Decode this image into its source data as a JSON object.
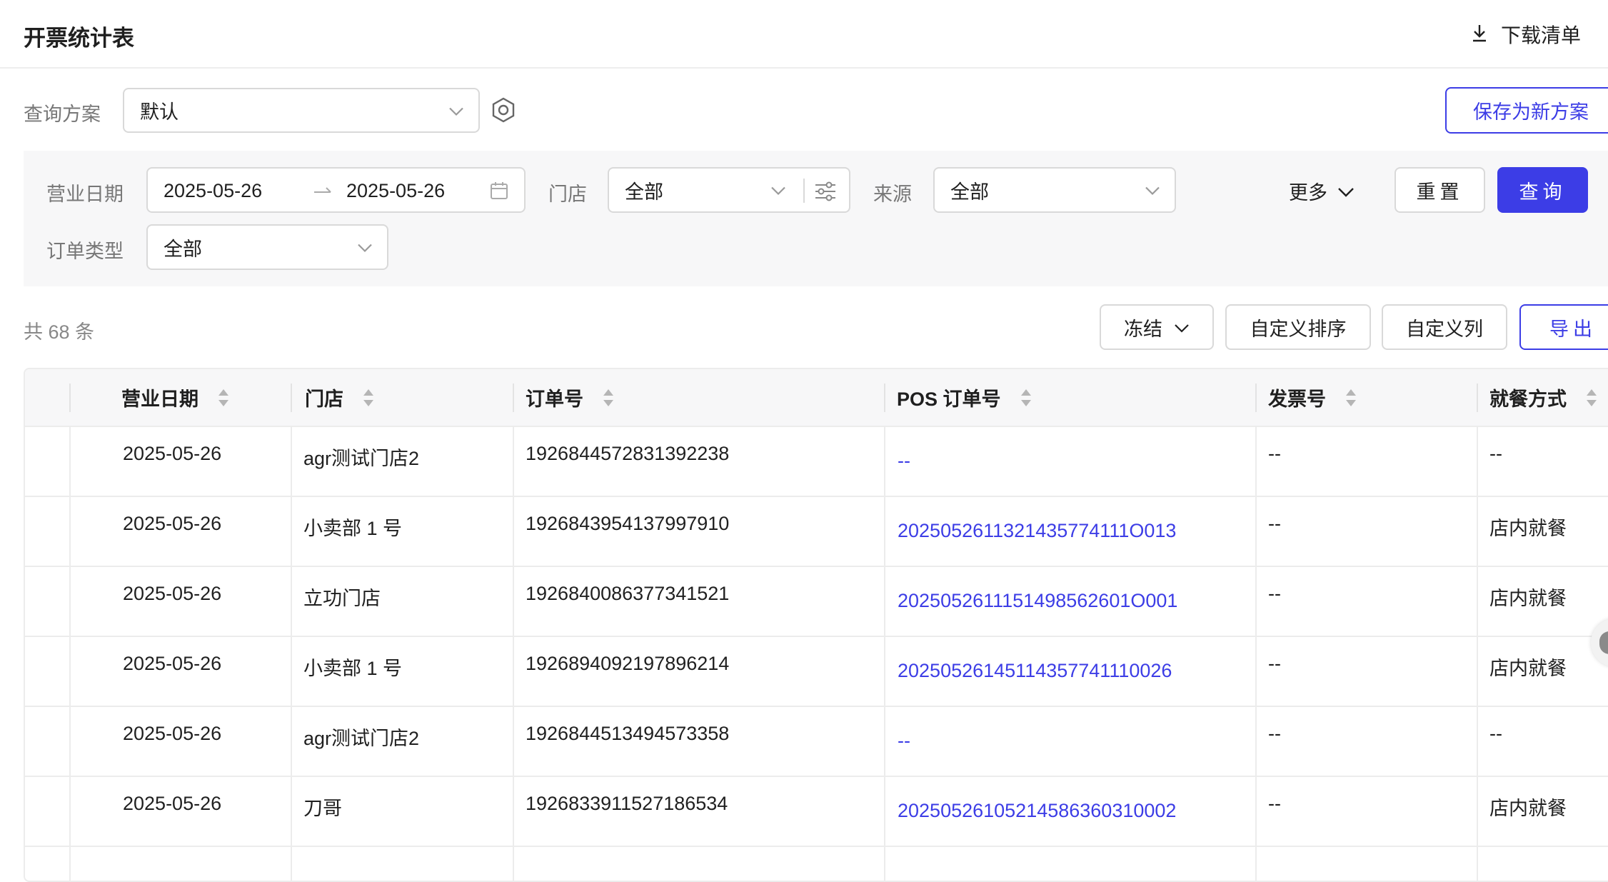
{
  "header": {
    "title": "开票统计表",
    "download_label": "下载清单"
  },
  "plan": {
    "label": "查询方案",
    "value": "默认",
    "save_label": "保存为新方案"
  },
  "filters": {
    "date_label": "营业日期",
    "date_start": "2025-05-26",
    "date_end": "2025-05-26",
    "store_label": "门店",
    "store_value": "全部",
    "source_label": "来源",
    "source_value": "全部",
    "more_label": "更多",
    "reset_label": "重置",
    "query_label": "查询",
    "order_type_label": "订单类型",
    "order_type_value": "全部"
  },
  "toolbar": {
    "total_text": "共 68 条",
    "freeze_label": "冻结",
    "custom_sort_label": "自定义排序",
    "custom_columns_label": "自定义列",
    "export_label": "导出"
  },
  "table": {
    "columns": [
      "营业日期",
      "门店",
      "订单号",
      "POS 订单号",
      "发票号",
      "就餐方式"
    ],
    "rows": [
      {
        "date": "2025-05-26",
        "store": "agr测试门店2",
        "order_no": "1926844572831392238",
        "pos_no": "--",
        "invoice_no": "--",
        "dining": "--"
      },
      {
        "date": "2025-05-26",
        "store": "小卖部 1 号",
        "order_no": "1926843954137997910",
        "pos_no": "2025052611321435774111O013",
        "invoice_no": "--",
        "dining": "店内就餐"
      },
      {
        "date": "2025-05-26",
        "store": "立功门店",
        "order_no": "1926840086377341521",
        "pos_no": "2025052611151498562601O001",
        "invoice_no": "--",
        "dining": "店内就餐"
      },
      {
        "date": "2025-05-26",
        "store": "小卖部 1 号",
        "order_no": "1926894092197896214",
        "pos_no": "20250526145114357741110026",
        "invoice_no": "--",
        "dining": "店内就餐"
      },
      {
        "date": "2025-05-26",
        "store": "agr测试门店2",
        "order_no": "1926844513494573358",
        "pos_no": "--",
        "invoice_no": "--",
        "dining": "--"
      },
      {
        "date": "2025-05-26",
        "store": "刀哥",
        "order_no": "1926833911527186534",
        "pos_no": "20250526105214586360310002",
        "invoice_no": "--",
        "dining": "店内就餐"
      }
    ]
  },
  "colors": {
    "primary": "#3c3de6",
    "label_gray": "#777777",
    "border": "#d9d9d9"
  }
}
